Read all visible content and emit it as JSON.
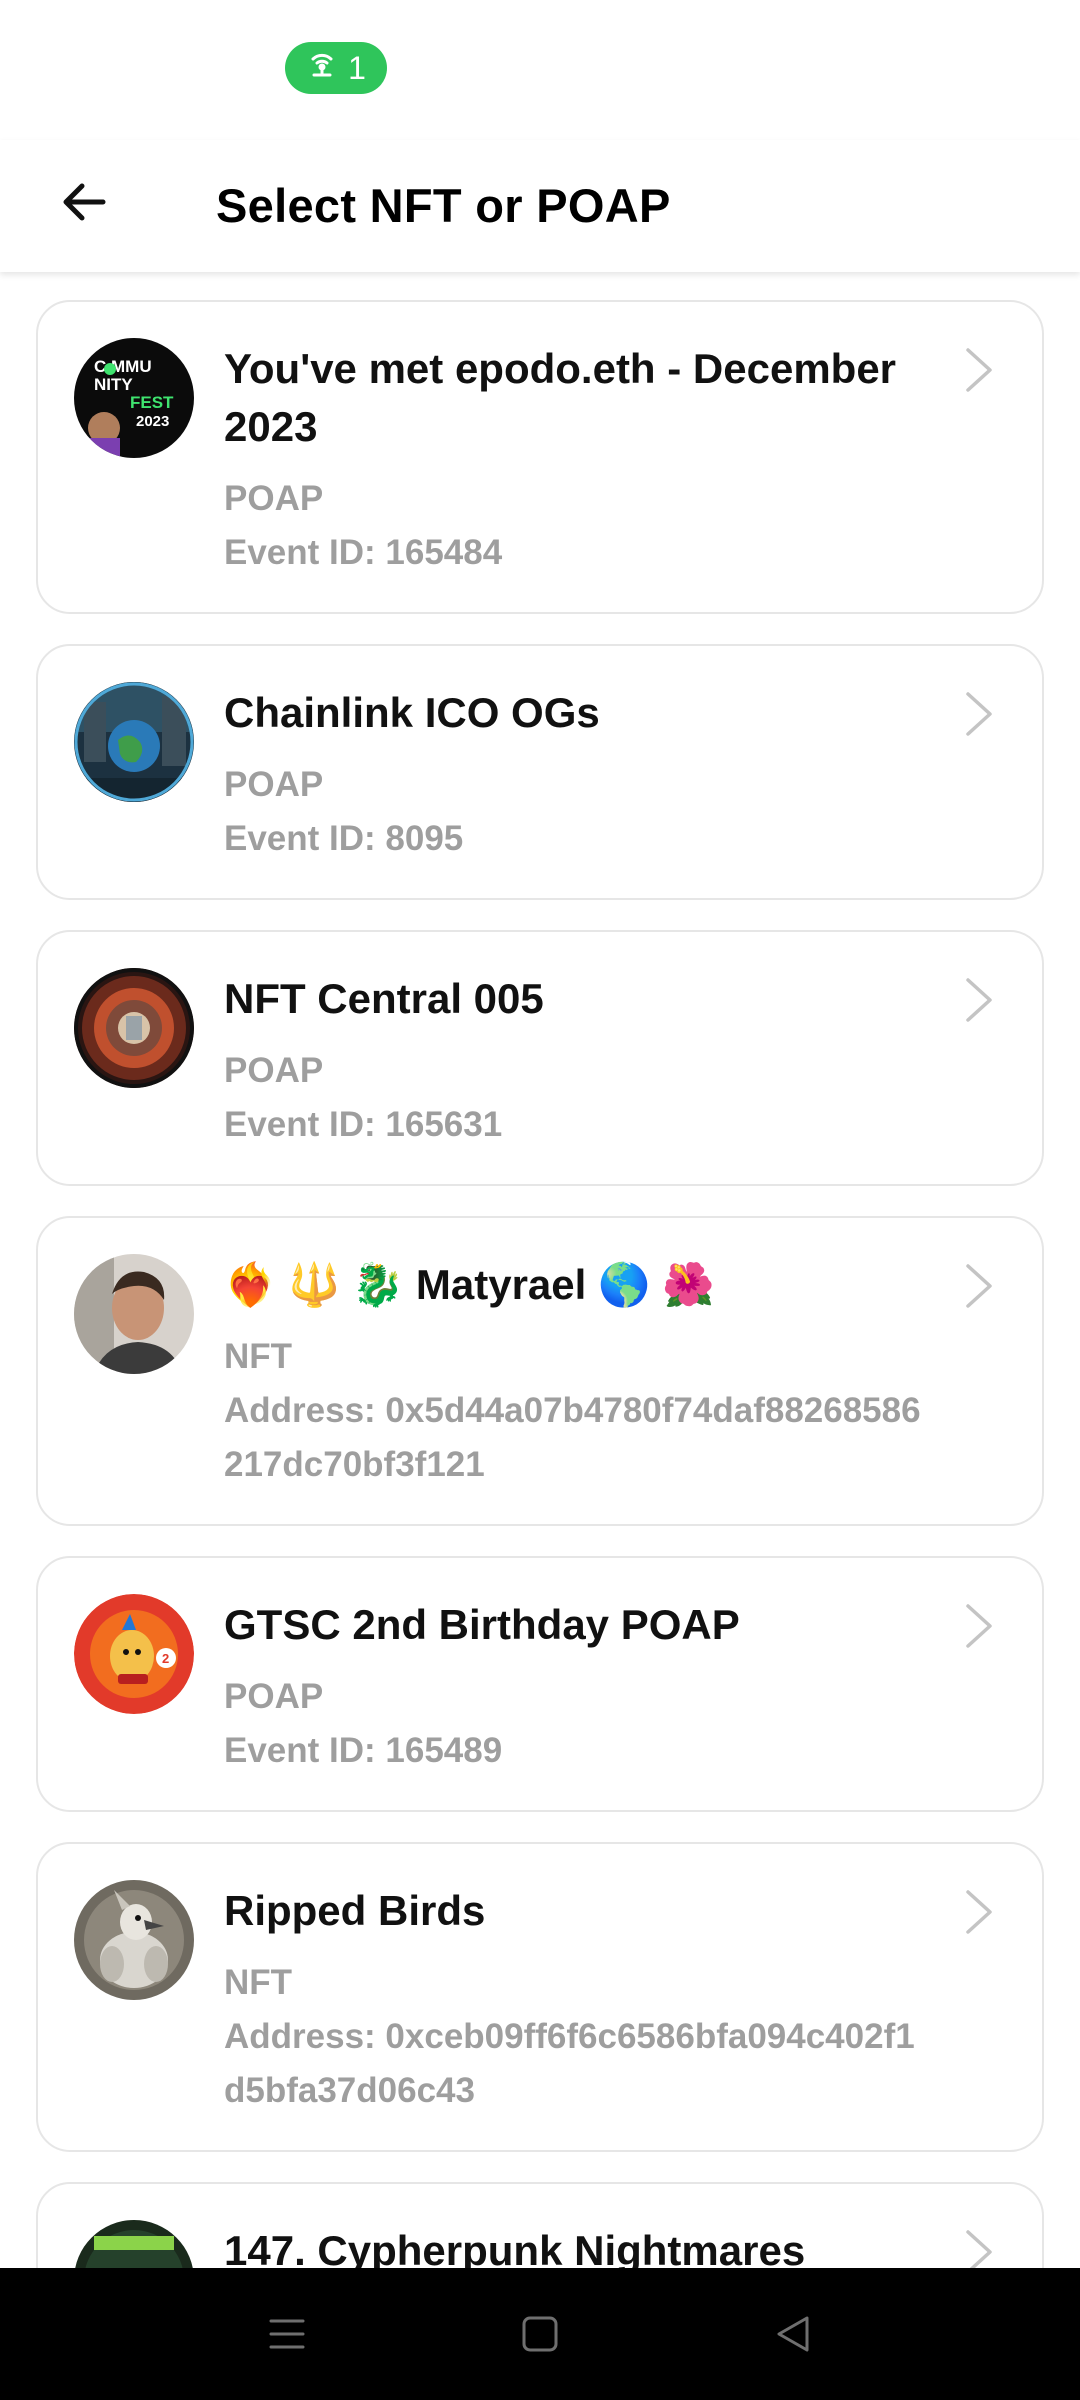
{
  "status_bar": {
    "hotspot_count": "1"
  },
  "header": {
    "title": "Select NFT or POAP"
  },
  "items": [
    {
      "title": "You've met epodo.eth - December 2023",
      "type": "POAP",
      "meta": "Event ID: 165484",
      "avatar": "community-fest-avatar"
    },
    {
      "title": "Chainlink ICO OGs",
      "type": "POAP",
      "meta": "Event ID: 8095",
      "avatar": "chainlink-avatar"
    },
    {
      "title": "NFT Central 005",
      "type": "POAP",
      "meta": "Event ID: 165631",
      "avatar": "tunnel-avatar"
    },
    {
      "title": "❤️‍🔥 🔱 🐉 Matyrael 🌎 🌺",
      "type": "NFT",
      "meta": "Address: 0x5d44a07b4780f74daf88268586217dc70bf3f121",
      "avatar": "person-avatar"
    },
    {
      "title": "GTSC 2nd Birthday POAP",
      "type": "POAP",
      "meta": "Event ID: 165489",
      "avatar": "birthday-avatar"
    },
    {
      "title": "Ripped Birds",
      "type": "NFT",
      "meta": "Address: 0xceb09ff6f6c6586bfa094c402f1d5bfa37d06c43",
      "avatar": "bird-avatar"
    },
    {
      "title": "147. Cypherpunk Nightmares",
      "type": "",
      "meta": "",
      "avatar": "cypherpunk-avatar"
    }
  ],
  "colors": {
    "accent_green": "#2fc55b",
    "muted_text": "#9e9e9e",
    "card_border": "#e6e6e6"
  }
}
